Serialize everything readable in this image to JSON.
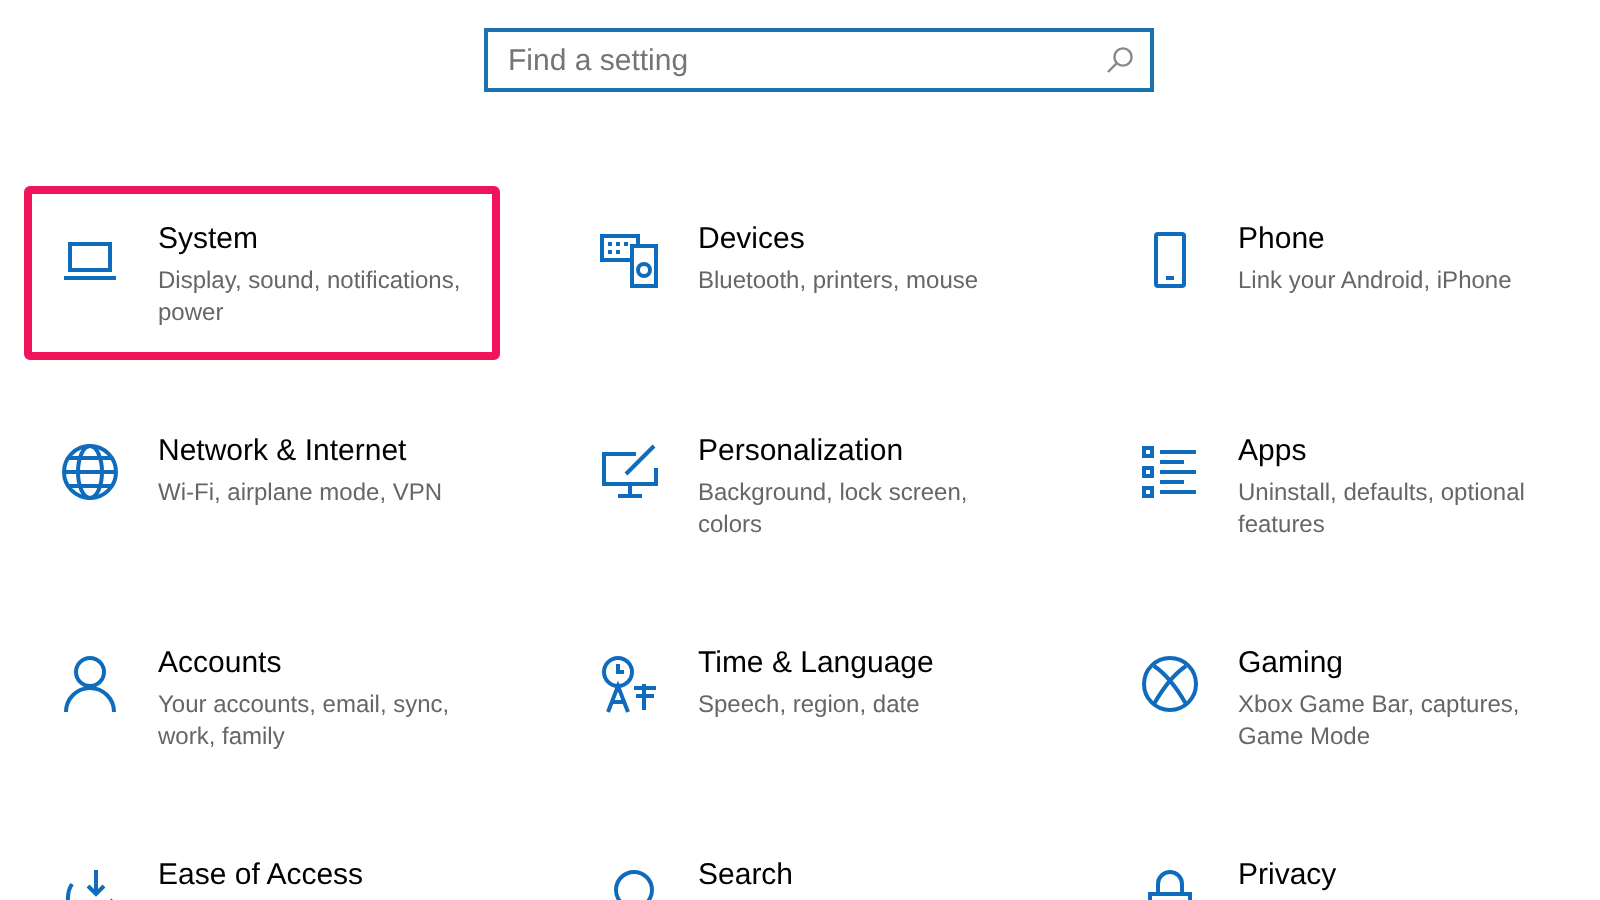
{
  "search": {
    "placeholder": "Find a setting"
  },
  "categories": [
    {
      "title": "System",
      "description": "Display, sound, notifications, power",
      "selected": true
    },
    {
      "title": "Devices",
      "description": "Bluetooth, printers, mouse",
      "selected": false
    },
    {
      "title": "Phone",
      "description": "Link your Android, iPhone",
      "selected": false
    },
    {
      "title": "Network & Internet",
      "description": "Wi-Fi, airplane mode, VPN",
      "selected": false
    },
    {
      "title": "Personalization",
      "description": "Background, lock screen, colors",
      "selected": false
    },
    {
      "title": "Apps",
      "description": "Uninstall, defaults, optional features",
      "selected": false
    },
    {
      "title": "Accounts",
      "description": "Your accounts, email, sync, work, family",
      "selected": false
    },
    {
      "title": "Time & Language",
      "description": "Speech, region, date",
      "selected": false
    },
    {
      "title": "Gaming",
      "description": "Xbox Game Bar, captures, Game Mode",
      "selected": false
    },
    {
      "title": "Ease of Access",
      "selected": false
    },
    {
      "title": "Search",
      "selected": false
    },
    {
      "title": "Privacy",
      "selected": false
    }
  ]
}
